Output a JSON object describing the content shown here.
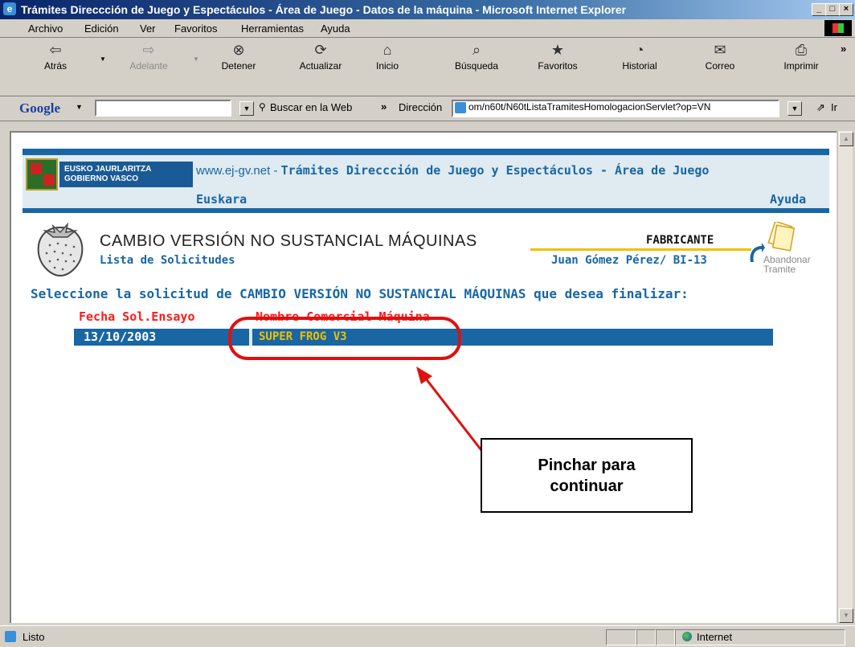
{
  "window": {
    "title": "Trámites Direccción de Juego y Espectáculos - Área de Juego - Datos de la máquina - Microsoft Internet Explorer",
    "buttons": {
      "minimize": "_",
      "maximize": "□",
      "close": "×"
    }
  },
  "menubar": [
    "Archivo",
    "Edición",
    "Ver",
    "Favoritos",
    "Herramientas",
    "Ayuda"
  ],
  "toolbar": [
    {
      "label": "Atrás",
      "icon": "back-arrow-icon",
      "glyph": "⇦",
      "enabled": true
    },
    {
      "label": "Adelante",
      "icon": "forward-arrow-icon",
      "glyph": "⇨",
      "enabled": false
    },
    {
      "label": "Detener",
      "icon": "stop-icon",
      "glyph": "⊗",
      "enabled": true
    },
    {
      "label": "Actualizar",
      "icon": "refresh-icon",
      "glyph": "⟳",
      "enabled": true
    },
    {
      "label": "Inicio",
      "icon": "home-icon",
      "glyph": "⌂",
      "enabled": true
    },
    {
      "label": "Búsqueda",
      "icon": "search-icon",
      "glyph": "⌕",
      "enabled": true
    },
    {
      "label": "Favoritos",
      "icon": "favorites-icon",
      "glyph": "★",
      "enabled": true
    },
    {
      "label": "Historial",
      "icon": "history-icon",
      "glyph": "◔",
      "enabled": true
    },
    {
      "label": "Correo",
      "icon": "mail-icon",
      "glyph": "✉",
      "enabled": true
    },
    {
      "label": "Imprimir",
      "icon": "print-icon",
      "glyph": "⎙",
      "enabled": true
    }
  ],
  "toolbar_overflow": "»",
  "google_bar": {
    "brand": "Google",
    "search_value": "",
    "search_web_label": "Buscar en la Web",
    "overflow": "»"
  },
  "address": {
    "label": "Dirección",
    "url": "om/n60t/N60tListaTramitesHomologacionServlet?op=VN",
    "go_label": "Ir"
  },
  "page": {
    "logo": {
      "line1": "EUSKO JAURLARITZA",
      "line2": "GOBIERNO VASCO"
    },
    "site_link": "www.ej-gv.net",
    "separator": " - ",
    "header_title": "Trámites Direccción de Juego y Espectáculos - Área de Juego",
    "language_link": "Euskara",
    "help_link": "Ayuda",
    "section_title": "CAMBIO VERSIÓN NO SUSTANCIAL MÁQUINAS",
    "section_subtitle": "Lista de Solicitudes",
    "role_label": "FABRICANTE",
    "user_label": "Juan Gómez Pérez/ BI-13",
    "abandon_line1": "Abandonar",
    "abandon_line2": "Tramite",
    "instructions": "Seleccione la solicitud de CAMBIO VERSIÓN NO SUSTANCIAL MÁQUINAS que desea finalizar:",
    "table": {
      "columns": [
        "Fecha Sol.Ensayo",
        "Nombre Comercial Máquina"
      ],
      "rows": [
        [
          "13/10/2003",
          "SUPER FROG V3"
        ]
      ]
    }
  },
  "annotation": {
    "callout_line1": "Pinchar para",
    "callout_line2": "continuar",
    "color": "#e01010"
  },
  "statusbar": {
    "status": "Listo",
    "zone": "Internet"
  },
  "colors": {
    "brand_blue": "#1866a3",
    "header_bg": "#dfeaf1",
    "gold": "#f0c000",
    "column_header_red": "#ff1a1a"
  }
}
